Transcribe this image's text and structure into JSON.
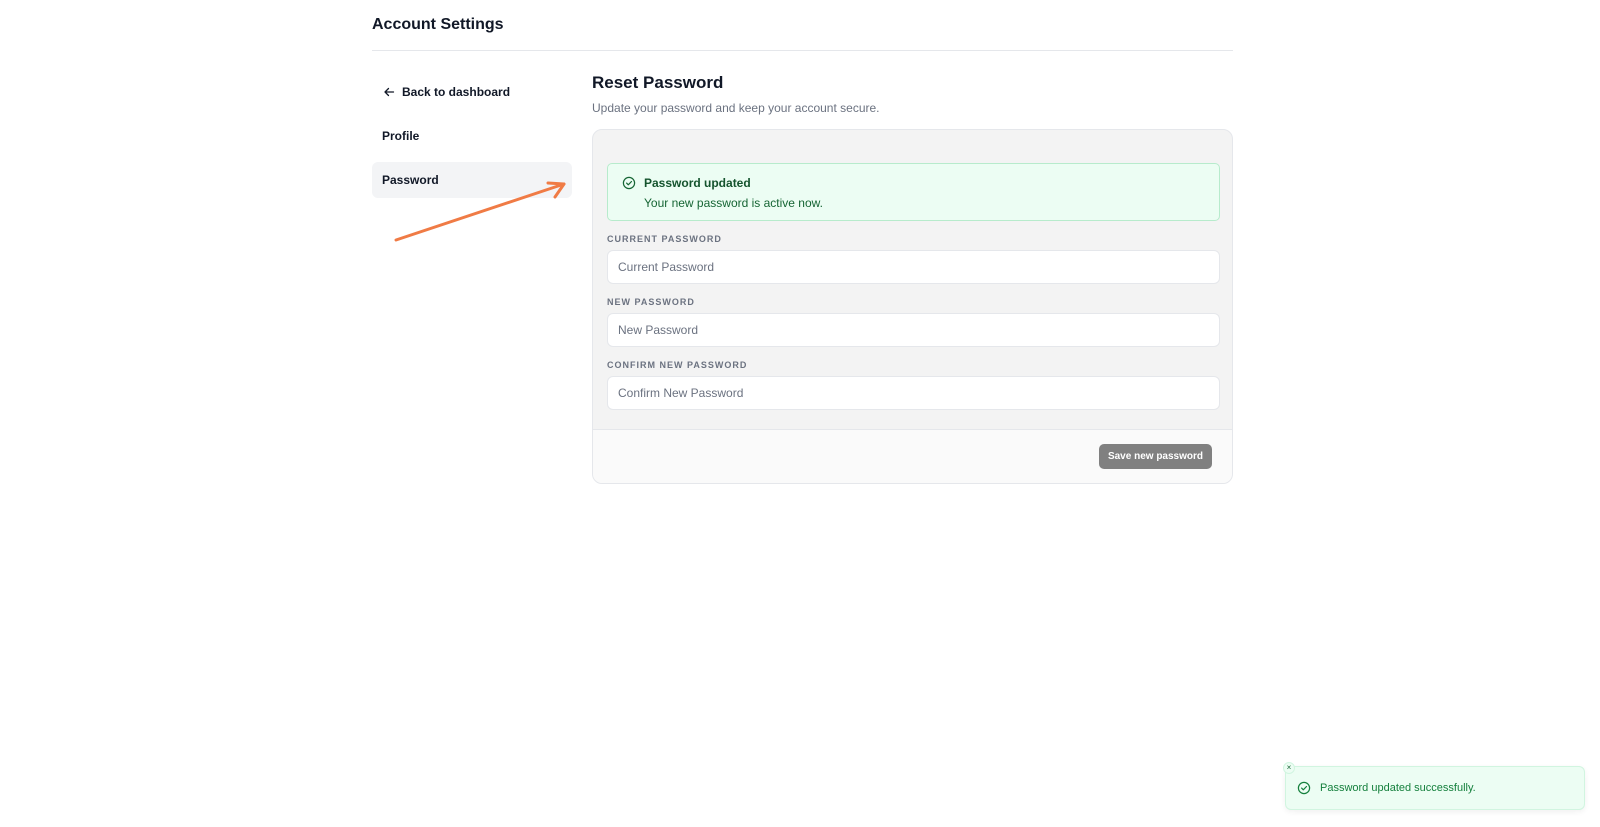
{
  "header": {
    "title": "Account Settings"
  },
  "sidebar": {
    "items": [
      {
        "label": "Back to dashboard",
        "icon": "arrow-left-icon"
      },
      {
        "label": "Profile"
      },
      {
        "label": "Password",
        "active": true
      }
    ]
  },
  "main": {
    "title": "Reset Password",
    "subtitle": "Update your password and keep your account secure."
  },
  "alert": {
    "title": "Password updated",
    "message": "Your new password is active now.",
    "icon": "check-circle-icon"
  },
  "form": {
    "current": {
      "label": "CURRENT PASSWORD",
      "placeholder": "Current Password",
      "value": ""
    },
    "new": {
      "label": "NEW PASSWORD",
      "placeholder": "New Password",
      "value": ""
    },
    "confirm": {
      "label": "CONFIRM NEW PASSWORD",
      "placeholder": "Confirm New Password",
      "value": ""
    },
    "save_label": "Save new password"
  },
  "toast": {
    "message": "Password updated successfully.",
    "close_glyph": "×",
    "icon": "check-circle-icon"
  },
  "colors": {
    "success_bg": "#ecfdf3",
    "success_text": "#166534",
    "button_disabled": "#808080",
    "annotation": "#f07b45"
  }
}
